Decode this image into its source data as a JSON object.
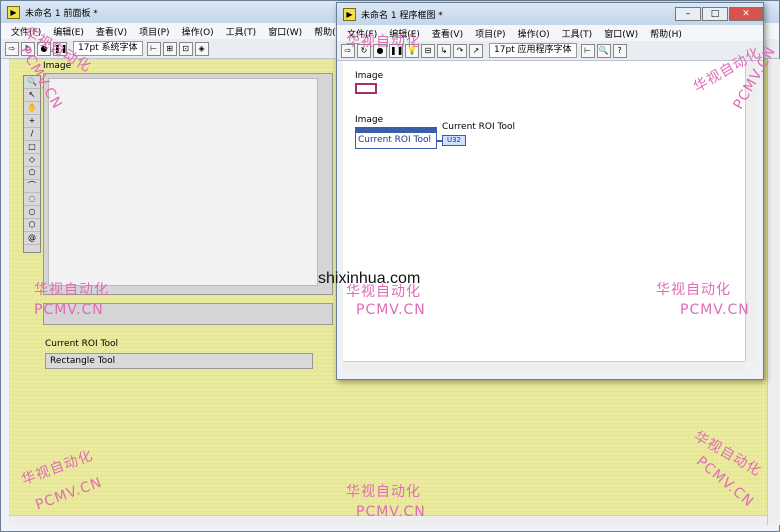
{
  "front_panel": {
    "title": "未命名 1 前面板 *",
    "menu": [
      "文件(F)",
      "编辑(E)",
      "查看(V)",
      "项目(P)",
      "操作(O)",
      "工具(T)",
      "窗口(W)",
      "帮助(H)"
    ],
    "font": "17pt 系统字体",
    "image_label": "Image",
    "roi_label": "Current ROI Tool",
    "roi_value": "Rectangle Tool"
  },
  "block_diagram": {
    "title": "未命名 1 程序框图 *",
    "menu": [
      "文件(F)",
      "编辑(E)",
      "查看(V)",
      "项目(P)",
      "操作(O)",
      "工具(T)",
      "窗口(W)",
      "帮助(H)"
    ],
    "font": "17pt 应用程序字体",
    "image_label_top": "Image",
    "image_label_node": "Image",
    "property_item": "Current ROI Tool",
    "indicator_label": "Current ROI Tool",
    "indicator_type": "U32"
  },
  "watermarks": {
    "cn": "华视自动化",
    "en": "PCMV.CN",
    "logo_text": "shixinhua.com"
  }
}
